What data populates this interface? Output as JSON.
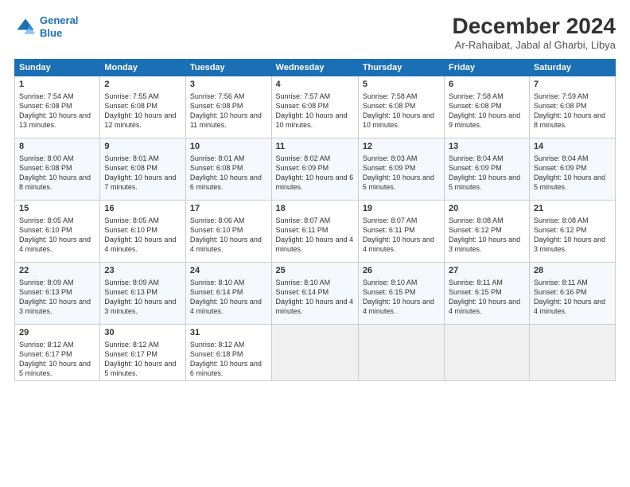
{
  "logo": {
    "line1": "General",
    "line2": "Blue"
  },
  "title": "December 2024",
  "subtitle": "Ar-Rahaibat, Jabal al Gharbi, Libya",
  "days_of_week": [
    "Sunday",
    "Monday",
    "Tuesday",
    "Wednesday",
    "Thursday",
    "Friday",
    "Saturday"
  ],
  "weeks": [
    [
      {
        "day": "1",
        "info": "Sunrise: 7:54 AM\nSunset: 6:08 PM\nDaylight: 10 hours and 13 minutes."
      },
      {
        "day": "2",
        "info": "Sunrise: 7:55 AM\nSunset: 6:08 PM\nDaylight: 10 hours and 12 minutes."
      },
      {
        "day": "3",
        "info": "Sunrise: 7:56 AM\nSunset: 6:08 PM\nDaylight: 10 hours and 11 minutes."
      },
      {
        "day": "4",
        "info": "Sunrise: 7:57 AM\nSunset: 6:08 PM\nDaylight: 10 hours and 10 minutes."
      },
      {
        "day": "5",
        "info": "Sunrise: 7:58 AM\nSunset: 6:08 PM\nDaylight: 10 hours and 10 minutes."
      },
      {
        "day": "6",
        "info": "Sunrise: 7:58 AM\nSunset: 6:08 PM\nDaylight: 10 hours and 9 minutes."
      },
      {
        "day": "7",
        "info": "Sunrise: 7:59 AM\nSunset: 6:08 PM\nDaylight: 10 hours and 8 minutes."
      }
    ],
    [
      {
        "day": "8",
        "info": "Sunrise: 8:00 AM\nSunset: 6:08 PM\nDaylight: 10 hours and 8 minutes."
      },
      {
        "day": "9",
        "info": "Sunrise: 8:01 AM\nSunset: 6:08 PM\nDaylight: 10 hours and 7 minutes."
      },
      {
        "day": "10",
        "info": "Sunrise: 8:01 AM\nSunset: 6:08 PM\nDaylight: 10 hours and 6 minutes."
      },
      {
        "day": "11",
        "info": "Sunrise: 8:02 AM\nSunset: 6:09 PM\nDaylight: 10 hours and 6 minutes."
      },
      {
        "day": "12",
        "info": "Sunrise: 8:03 AM\nSunset: 6:09 PM\nDaylight: 10 hours and 5 minutes."
      },
      {
        "day": "13",
        "info": "Sunrise: 8:04 AM\nSunset: 6:09 PM\nDaylight: 10 hours and 5 minutes."
      },
      {
        "day": "14",
        "info": "Sunrise: 8:04 AM\nSunset: 6:09 PM\nDaylight: 10 hours and 5 minutes."
      }
    ],
    [
      {
        "day": "15",
        "info": "Sunrise: 8:05 AM\nSunset: 6:10 PM\nDaylight: 10 hours and 4 minutes."
      },
      {
        "day": "16",
        "info": "Sunrise: 8:05 AM\nSunset: 6:10 PM\nDaylight: 10 hours and 4 minutes."
      },
      {
        "day": "17",
        "info": "Sunrise: 8:06 AM\nSunset: 6:10 PM\nDaylight: 10 hours and 4 minutes."
      },
      {
        "day": "18",
        "info": "Sunrise: 8:07 AM\nSunset: 6:11 PM\nDaylight: 10 hours and 4 minutes."
      },
      {
        "day": "19",
        "info": "Sunrise: 8:07 AM\nSunset: 6:11 PM\nDaylight: 10 hours and 4 minutes."
      },
      {
        "day": "20",
        "info": "Sunrise: 8:08 AM\nSunset: 6:12 PM\nDaylight: 10 hours and 3 minutes."
      },
      {
        "day": "21",
        "info": "Sunrise: 8:08 AM\nSunset: 6:12 PM\nDaylight: 10 hours and 3 minutes."
      }
    ],
    [
      {
        "day": "22",
        "info": "Sunrise: 8:09 AM\nSunset: 6:13 PM\nDaylight: 10 hours and 3 minutes."
      },
      {
        "day": "23",
        "info": "Sunrise: 8:09 AM\nSunset: 6:13 PM\nDaylight: 10 hours and 3 minutes."
      },
      {
        "day": "24",
        "info": "Sunrise: 8:10 AM\nSunset: 6:14 PM\nDaylight: 10 hours and 4 minutes."
      },
      {
        "day": "25",
        "info": "Sunrise: 8:10 AM\nSunset: 6:14 PM\nDaylight: 10 hours and 4 minutes."
      },
      {
        "day": "26",
        "info": "Sunrise: 8:10 AM\nSunset: 6:15 PM\nDaylight: 10 hours and 4 minutes."
      },
      {
        "day": "27",
        "info": "Sunrise: 8:11 AM\nSunset: 6:15 PM\nDaylight: 10 hours and 4 minutes."
      },
      {
        "day": "28",
        "info": "Sunrise: 8:11 AM\nSunset: 6:16 PM\nDaylight: 10 hours and 4 minutes."
      }
    ],
    [
      {
        "day": "29",
        "info": "Sunrise: 8:12 AM\nSunset: 6:17 PM\nDaylight: 10 hours and 5 minutes."
      },
      {
        "day": "30",
        "info": "Sunrise: 8:12 AM\nSunset: 6:17 PM\nDaylight: 10 hours and 5 minutes."
      },
      {
        "day": "31",
        "info": "Sunrise: 8:12 AM\nSunset: 6:18 PM\nDaylight: 10 hours and 6 minutes."
      },
      {
        "day": "",
        "info": ""
      },
      {
        "day": "",
        "info": ""
      },
      {
        "day": "",
        "info": ""
      },
      {
        "day": "",
        "info": ""
      }
    ]
  ]
}
